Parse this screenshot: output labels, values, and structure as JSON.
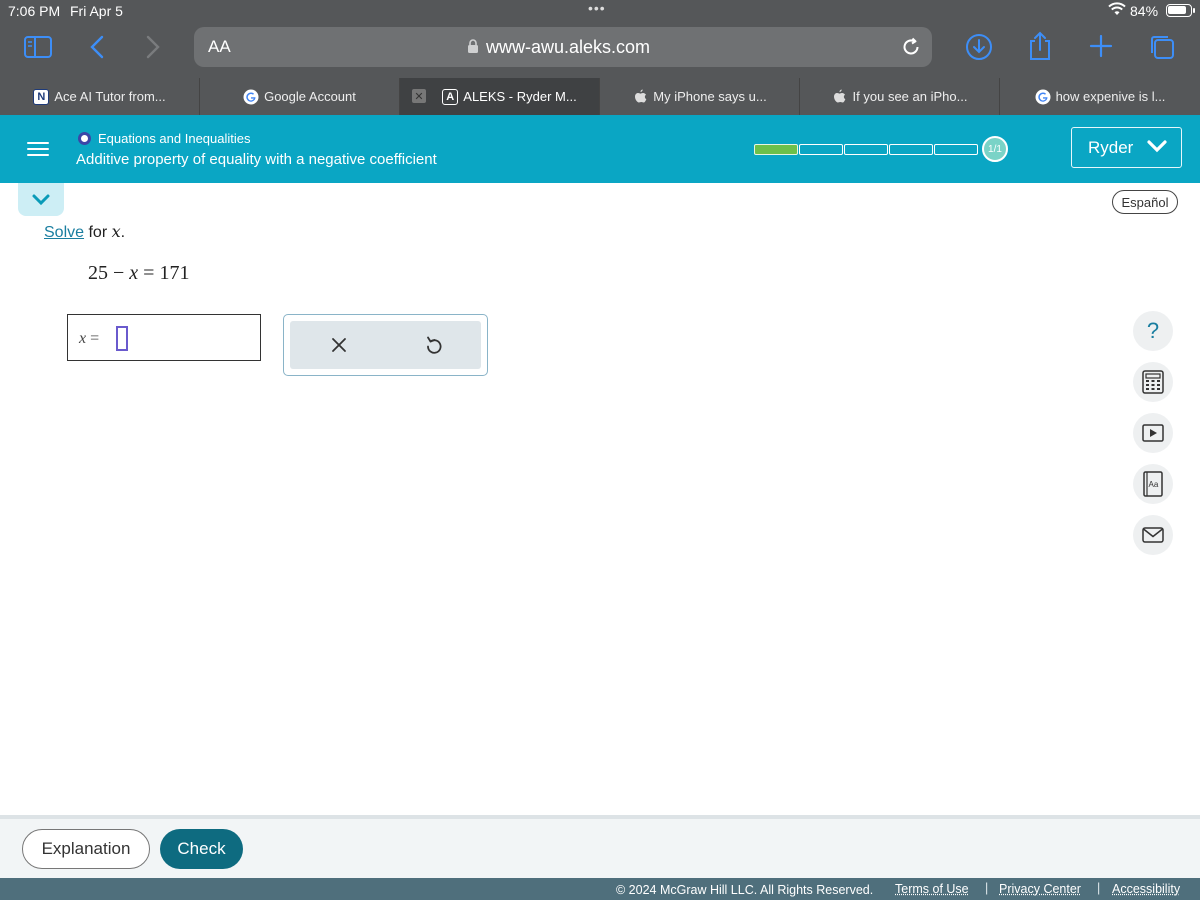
{
  "status_bar": {
    "time": "7:06 PM",
    "date": "Fri Apr 5",
    "battery": "84%",
    "battery_level": 0.84
  },
  "browser": {
    "text_size_label": "AA",
    "url": "www-awu.aleks.com",
    "tabs": [
      {
        "title": "Ace AI Tutor from...",
        "favicon": "N",
        "active": false
      },
      {
        "title": "Google Account",
        "favicon": "google-icon",
        "active": false
      },
      {
        "title": "ALEKS - Ryder M...",
        "favicon": "A",
        "active": true
      },
      {
        "title": "My iPhone says u...",
        "favicon": "apple-icon",
        "active": false
      },
      {
        "title": "If you see an iPho...",
        "favicon": "apple-icon",
        "active": false
      },
      {
        "title": "how expenive is l...",
        "favicon": "google-icon",
        "active": false
      }
    ]
  },
  "aleks": {
    "topic": "Equations and Inequalities",
    "subtopic": "Additive property of equality with a negative coefficient",
    "progress": {
      "segments_total": 5,
      "segments_filled": 1,
      "badge_text": "1/1"
    },
    "user_name": "Ryder",
    "language_button": "Español",
    "colors": {
      "header": "#0aa6c4",
      "progress_fill": "#6cc04a",
      "check_button": "#0e6b80",
      "footer": "#4f6f7c"
    }
  },
  "problem": {
    "instruction_link": "Solve",
    "instruction_rest": " for ",
    "instruction_var": "x",
    "instruction_end": ".",
    "equation": {
      "left_num": "25",
      "minus": "−",
      "var": "x",
      "equals": "=",
      "right_num": "171"
    },
    "answer_label_var": "x",
    "answer_label_eq": "=",
    "answer_value": ""
  },
  "side_tools": [
    "help-icon",
    "calculator-icon",
    "video-icon",
    "dictionary-icon",
    "message-icon"
  ],
  "side_tool_help_text": "?",
  "buttons": {
    "explanation": "Explanation",
    "check": "Check"
  },
  "footer": {
    "copyright": "© 2024 McGraw Hill LLC. All Rights Reserved.",
    "terms": "Terms of Use",
    "privacy": "Privacy Center",
    "accessibility": "Accessibility",
    "separator": "|"
  }
}
